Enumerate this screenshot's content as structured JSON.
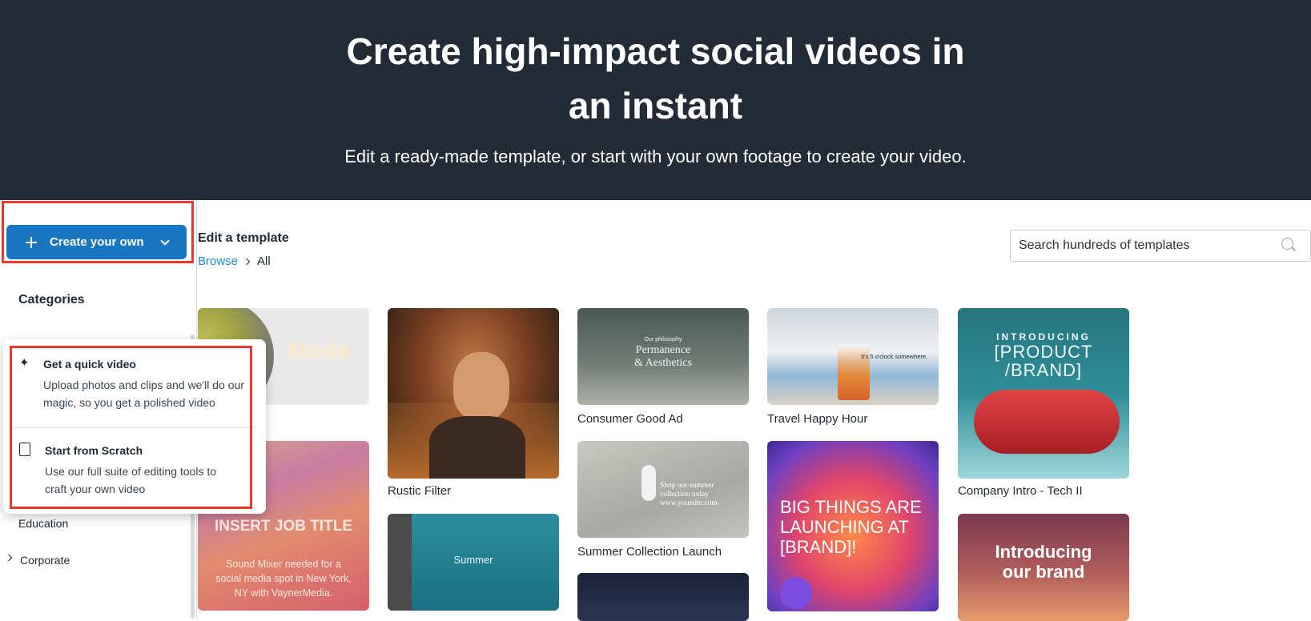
{
  "hero": {
    "title_line1": "Create high-impact social videos in",
    "title_line2": "an instant",
    "subtitle": "Edit a ready-made template, or start with your own footage to create your video."
  },
  "sidebar": {
    "create_button": "Create your own",
    "categories_heading": "Categories",
    "items": [
      "Education",
      "Corporate"
    ]
  },
  "create_menu": {
    "items": [
      {
        "title": "Get a quick video",
        "description": "Upload photos and clips and we'll do our magic, so you get a polished video",
        "icon": "sparkle-icon"
      },
      {
        "title": "Start from Scratch",
        "description": "Use our full suite of editing tools to craft your own video",
        "icon": "document-icon"
      }
    ]
  },
  "main": {
    "section_title": "Edit a template",
    "breadcrumb": {
      "link": "Browse",
      "current": "All"
    },
    "search_placeholder": "Search hundreds of templates"
  },
  "templates": {
    "dark_mode_text": "Mode",
    "rustic": "Rustic Filter",
    "consumer": "Consumer Good Ad",
    "consumer_small": "Our philosophy",
    "consumer_big1": "Permanence",
    "consumer_big2": "& Aesthetics",
    "travel": "Travel Happy Hour",
    "travel_overlay": "It's 5 o'clock somewhere.",
    "company": "Company Intro - Tech II",
    "company_intro": "INTRODUCING",
    "company_product": "[PRODUCT /BRAND]",
    "job_title": "INSERT JOB TITLE",
    "job_desc": "Sound Mixer needed for a social media spot in New York, NY with VaynerMedia.",
    "summer_pool": "Summer",
    "summer_launch": "Summer Collection Launch",
    "summer_overlay": "Shop our summer collection today www.yoursite.com",
    "big_things": "BIG THINGS ARE LAUNCHING AT [BRAND]!",
    "intro_brand": "Introducing our brand"
  }
}
